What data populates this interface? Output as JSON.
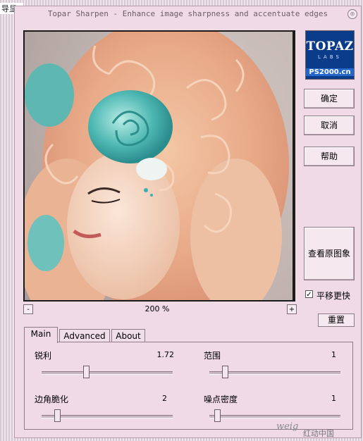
{
  "background": {
    "corner_text": "导显3"
  },
  "window": {
    "title": "Topar Sharpen - Enhance image sharpness and accentuate edges",
    "close_glyph": "◎"
  },
  "logo": {
    "line1": "TOPAZ",
    "line2": "LABS",
    "line3": "PS2000.cn"
  },
  "buttons": {
    "ok": "确定",
    "cancel": "取消",
    "help": "帮助",
    "view_original": "查看原图象",
    "reset": "重置"
  },
  "zoom": {
    "minus": "-",
    "plus": "+",
    "level": "200 %"
  },
  "pan_checkbox": {
    "label": "平移更快",
    "checked": true,
    "mark": "✓"
  },
  "tabs": [
    {
      "label": "Main",
      "active": true
    },
    {
      "label": "Advanced",
      "active": false
    },
    {
      "label": "About",
      "active": false
    }
  ],
  "params": {
    "sharpness": {
      "label": "锐利",
      "value": "1.72",
      "level": 0.34
    },
    "radius": {
      "label": "范围",
      "value": "1",
      "level": 0.12
    },
    "edge_brittle": {
      "label": "边角脆化",
      "value": "2",
      "level": 0.12
    },
    "noise_density": {
      "label": "噪点密度",
      "value": "1",
      "level": 0.06
    }
  },
  "watermark": {
    "text": "weig",
    "text2": "红动中国"
  },
  "colors": {
    "window_bg": "#efdae6",
    "logo_bg": "#0a3c8a"
  },
  "preview": {
    "icon": "portrait-image"
  }
}
